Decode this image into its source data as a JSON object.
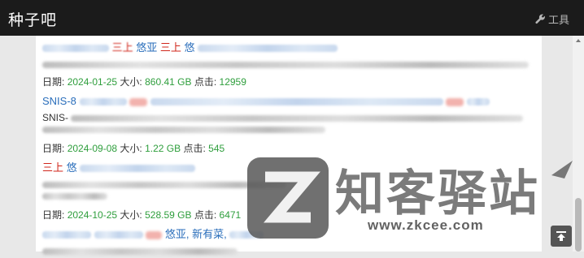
{
  "header": {
    "brand": "种子吧",
    "tools_label": "工具",
    "tools_icon": "wrench-icon"
  },
  "results": [
    {
      "title_red_1": "三上",
      "title_mid": "悠亚",
      "title_red_2": "三上",
      "title_tail": "悠",
      "date_label": "日期:",
      "date": "2024-01-25",
      "size_label": "大小:",
      "size": "860.41 GB",
      "clicks_label": "点击:",
      "clicks": "12959"
    },
    {
      "title_prefix": "SNIS-8",
      "desc_prefix": "SNIS-",
      "date_label": "日期:",
      "date": "2024-09-08",
      "size_label": "大小:",
      "size": "1.22 GB",
      "clicks_label": "点击:",
      "clicks": "545"
    },
    {
      "title_red_1": "三上",
      "title_tail": "悠",
      "date_label": "日期:",
      "date": "2024-10-25",
      "size_label": "大小:",
      "size": "528.59 GB",
      "clicks_label": "点击:",
      "clicks": "6471"
    },
    {
      "title_mid": "悠亚, 新有菜,"
    }
  ],
  "watermark": {
    "name": "知客驿站",
    "url": "www.zkcee.com"
  },
  "colors": {
    "link": "#2a6ebb",
    "highlight": "#d0261b",
    "value": "#2e9e3c",
    "topbar": "#1b1b1b"
  }
}
